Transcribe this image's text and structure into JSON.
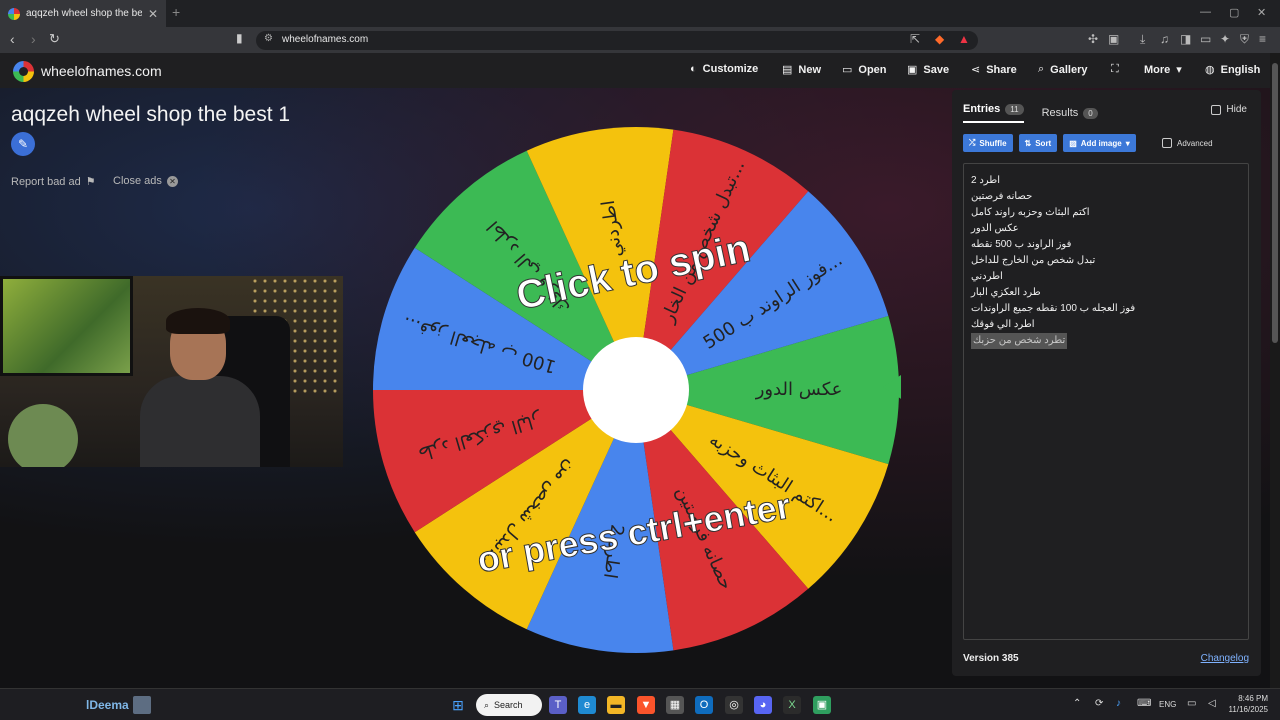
{
  "browser": {
    "tab_title": "aqqzeh wheel shop the best 1",
    "tab_close": "✕",
    "new_tab": "+",
    "url": "wheelofnames.com",
    "window": {
      "minimize": "—",
      "maximize": "▢",
      "close": "✕"
    }
  },
  "site": {
    "name": "wheelofnames.com",
    "menu": [
      {
        "icon": "palette-icon",
        "glyph": "◐",
        "label": "Customize"
      },
      {
        "icon": "file-icon",
        "glyph": "▤",
        "label": "New"
      },
      {
        "icon": "folder-icon",
        "glyph": "▭",
        "label": "Open"
      },
      {
        "icon": "save-icon",
        "glyph": "▣",
        "label": "Save"
      },
      {
        "icon": "share-icon",
        "glyph": "⋖",
        "label": "Share"
      },
      {
        "icon": "search-icon",
        "glyph": "⌕",
        "label": "Gallery"
      },
      {
        "icon": "fullscreen-icon",
        "glyph": "⛶",
        "label": ""
      },
      {
        "icon": "chevron-down-icon",
        "glyph": "▾",
        "label": "More"
      },
      {
        "icon": "globe-icon",
        "glyph": "◍",
        "label": "English"
      }
    ]
  },
  "page": {
    "title": "aqqzeh wheel shop the best 1",
    "report_ad": "Report bad ad",
    "close_ads": "Close ads"
  },
  "wheel": {
    "overlay_top": "Click to spin",
    "overlay_bottom": "or press ctrl+enter",
    "colors": {
      "red": "#db3236",
      "yellow": "#f4c20d",
      "green": "#3cba54",
      "blue": "#4885ed",
      "pointer": "#3cba54"
    },
    "slices": [
      {
        "label": "عكس الدور",
        "color": "#3cba54"
      },
      {
        "label": "اكتم البثاث وحزبه...",
        "color": "#f4c20d"
      },
      {
        "label": "حصانه فرصتين",
        "color": "#db3236"
      },
      {
        "label": "اطرد 2",
        "color": "#4885ed"
      },
      {
        "label": "تبدل شخص من...",
        "color": "#f4c20d"
      },
      {
        "label": "طرد العكزي البار",
        "color": "#db3236"
      },
      {
        "label": "فوز العجله ب 100...",
        "color": "#4885ed"
      },
      {
        "label": "اطرد الي فوقك",
        "color": "#3cba54"
      },
      {
        "label": "اطردني",
        "color": "#f4c20d"
      },
      {
        "label": "تبدل شخص من الخار...",
        "color": "#db3236"
      },
      {
        "label": "فوز الراوند ب 500...",
        "color": "#4885ed"
      }
    ]
  },
  "sidebar": {
    "tab_entries": "Entries",
    "entries_count": "11",
    "tab_results": "Results",
    "results_count": "0",
    "hide": "Hide",
    "shuffle": "Shuffle",
    "sort": "Sort",
    "add_image": "Add image",
    "advanced": "Advanced",
    "entries": [
      "اطرد 2",
      "حصانه فرصتين",
      "اكتم البثاث وحزبه راوند كامل",
      "عكس الدور",
      "فوز الراوند ب 500 نقطه",
      "تبدل شخص من الخارج للداخل",
      "اطردني",
      "طرد العكزي البار",
      "فوز العجله ب 100 نقطه جميع الراوندات",
      "اطرد الي فوقك",
      "تطرد شخص من حزبك"
    ],
    "version": "Version 385",
    "changelog": "Changelog"
  },
  "taskbar": {
    "user_name": "lDeema",
    "search": "Search",
    "lang": "ENG",
    "time": "8:46 PM",
    "date": "11/16/2025"
  }
}
